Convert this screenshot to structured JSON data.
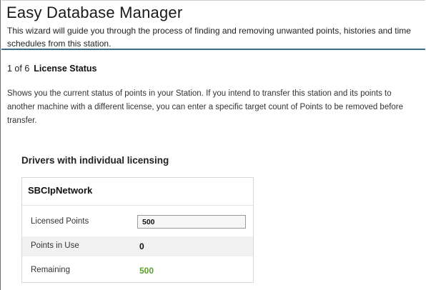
{
  "wizard": {
    "title": "Easy Database Manager",
    "description": "This wizard will guide you through the process of finding and removing unwanted points, histories and time schedules from this station."
  },
  "step": {
    "count": "1 of 6",
    "title": "License Status",
    "description": "Shows you the current status of points in your Station. If you intend to transfer this station and its points to another machine with a different license, you can enter a specific target count of Points to be removed before transfer."
  },
  "section": {
    "title": "Drivers with individual licensing"
  },
  "driver": {
    "name": "SBCIpNetwork",
    "licensed_label": "Licensed Points",
    "licensed_value": "500",
    "in_use_label": "Points in Use",
    "in_use_value": "0",
    "remaining_label": "Remaining",
    "remaining_value": "500"
  },
  "colors": {
    "header_rule": "#3a6b8a",
    "remaining_green": "#5aa02c"
  }
}
